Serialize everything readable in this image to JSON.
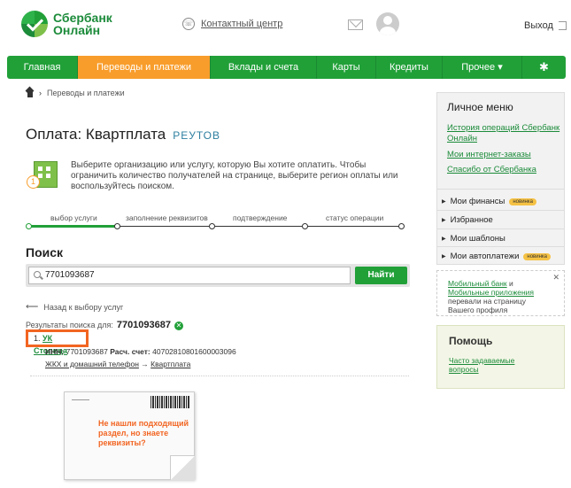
{
  "header": {
    "logo_line1": "Сбербанк",
    "logo_line2": "Онлайн",
    "contact_center": "Контактный центр",
    "exit_label": "Выход"
  },
  "nav": {
    "items": [
      {
        "label": "Главная",
        "active": false
      },
      {
        "label": "Переводы и платежи",
        "active": true
      },
      {
        "label": "Вклады и счета",
        "active": false
      },
      {
        "label": "Карты",
        "active": false
      },
      {
        "label": "Кредиты",
        "active": false
      },
      {
        "label": "Прочее ▾",
        "active": false
      }
    ],
    "settings_icon": "gear-icon"
  },
  "breadcrumb": {
    "link": "Переводы и платежи"
  },
  "page": {
    "title": "Оплата: Квартплата",
    "city": "РЕУТОВ",
    "info_number": "1",
    "info_text": "Выберите организацию или услугу, которую Вы хотите оплатить. Чтобы ограничить количество получателей на странице, выберите регион оплаты или воспользуйтесь поиском."
  },
  "steps": {
    "labels": [
      "выбор услуги",
      "заполнение реквизитов",
      "подтверждение",
      "статус операции"
    ],
    "current": 1
  },
  "search": {
    "title": "Поиск",
    "value": "7701093687",
    "button": "Найти"
  },
  "results": {
    "back_link": "Назад к выбору услуг",
    "prefix": "Результаты поиска для:",
    "query": "7701093687",
    "item_index": "1.",
    "item_name": "УК Столица",
    "inn_label": "ИНН:",
    "inn_value": "7701093687",
    "account_label": "Расч. счет:",
    "account_value": "40702810801600003096",
    "category": "ЖКХ и домашний телефон",
    "arrow": "→",
    "subcategory": "Квартплата"
  },
  "promo": {
    "text": "Не нашли подходящий раздел, но знаете реквизиты?"
  },
  "sidebar": {
    "title": "Личное меню",
    "links": [
      "История операций Сбербанк Онлайн",
      "Мои интернет-заказы",
      "Спасибо от Сбербанка"
    ],
    "sections": [
      {
        "label": "Мои финансы",
        "badge": "новинка"
      },
      {
        "label": "Избранное",
        "badge": ""
      },
      {
        "label": "Мои шаблоны",
        "badge": ""
      },
      {
        "label": "Мои автоплатежи",
        "badge": "новинка"
      }
    ],
    "app_part1": "Мобильный банк",
    "app_and": " и ",
    "app_part2": "Мобильные приложения",
    "app_rest": " перевали на страницу Вашего профиля",
    "close": "✕",
    "help_title": "Помощь",
    "help_link": "Часто задаваемые вопросы"
  }
}
